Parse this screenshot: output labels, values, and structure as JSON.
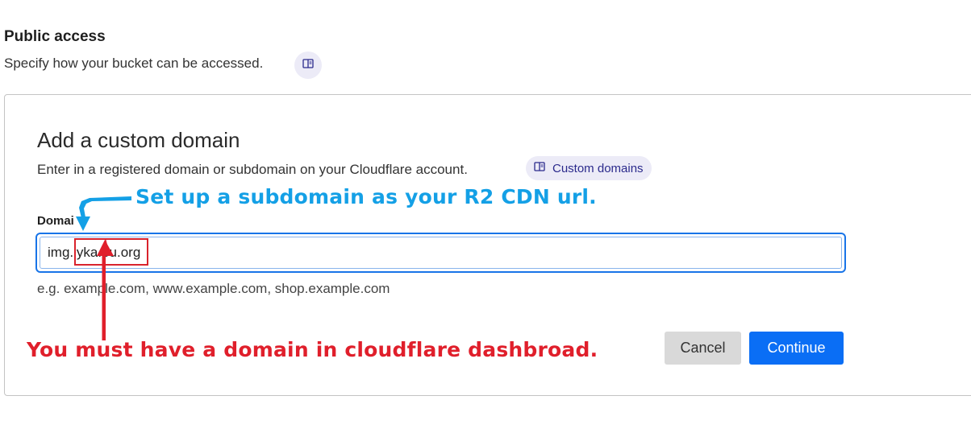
{
  "public_access": {
    "title": "Public access",
    "description": "Specify how your bucket can be accessed.",
    "doc_icon": "book-icon"
  },
  "custom_domain": {
    "title": "Add a custom domain",
    "description": "Enter in a registered domain or subdomain on your Cloudflare account.",
    "docs_link": {
      "label": "Custom domains",
      "icon": "book-icon"
    },
    "field_label": "Domai",
    "input_value": "img.lyka.eu.org",
    "hint": "e.g. example.com, www.example.com, shop.example.com",
    "buttons": {
      "cancel": "Cancel",
      "continue": "Continue"
    }
  },
  "annotations": {
    "blue_note": "Set up a subdomain as your R2 CDN url.",
    "red_note": "You must have a domain in cloudflare dashbroad."
  },
  "colors": {
    "primary_button": "#0a6ef5",
    "pill_background": "#ecebf7",
    "annotation_blue": "#14a0e6",
    "annotation_red": "#e01f2b",
    "focus_border": "#1874e8"
  }
}
